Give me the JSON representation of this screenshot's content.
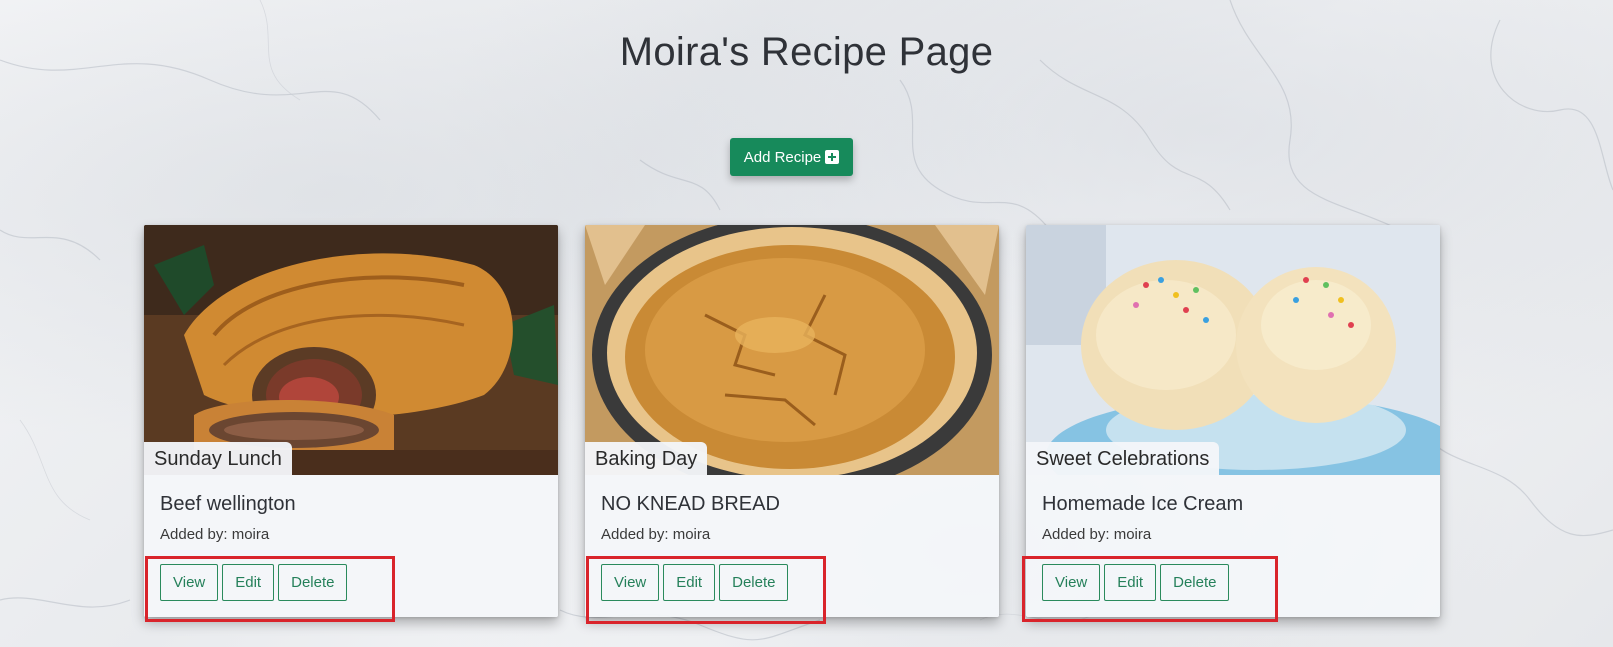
{
  "page": {
    "title": "Moira's Recipe Page"
  },
  "add_button": {
    "label": "Add Recipe",
    "icon": "plus-square-icon",
    "color": "#178a5b"
  },
  "recipes": [
    {
      "category": "Sunday Lunch",
      "title": "Beef wellington",
      "added_by": "Added by: moira",
      "image": "beef-wellington-photo",
      "actions": [
        "View",
        "Edit",
        "Delete"
      ]
    },
    {
      "category": "Baking Day",
      "title": "NO KNEAD BREAD",
      "added_by": "Added by: moira",
      "image": "bread-loaf-photo",
      "actions": [
        "View",
        "Edit",
        "Delete"
      ]
    },
    {
      "category": "Sweet Celebrations",
      "title": "Homemade Ice Cream",
      "added_by": "Added by: moira",
      "image": "ice-cream-photo",
      "actions": [
        "View",
        "Edit",
        "Delete"
      ]
    }
  ],
  "colors": {
    "accent": "#25805a",
    "annotation": "#d9242b"
  }
}
